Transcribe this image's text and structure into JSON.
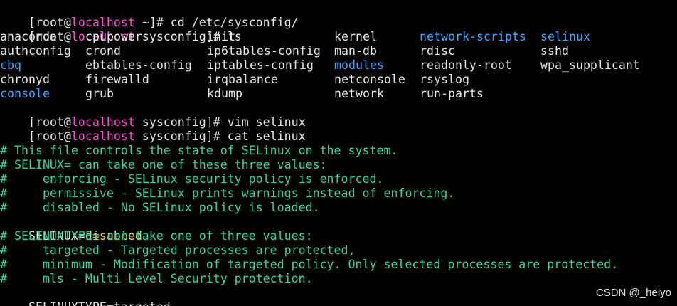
{
  "colors": {
    "background": "#000000",
    "text": "#e6e6e6",
    "host": "#ff4ad6",
    "comment": "#2ed8a2",
    "directory": "#3aa9ff",
    "value": "#e8dc4a"
  },
  "top_partial_line": "[root@localhost ~]# cd /etc/sysconfig/",
  "lines": [
    {
      "user": "[root@",
      "host": "localhost",
      "rest": " ~]# cd /etc/sysconfig/"
    },
    {
      "user": "[root@",
      "host": "localhost",
      "rest": " sysconfig]# ls"
    },
    {
      "user": "[root@",
      "host": "localhost",
      "rest": " sysconfig]# vim selinux"
    },
    {
      "user": "[root@",
      "host": "localhost",
      "rest": " sysconfig]# cat selinux"
    }
  ],
  "ls_grid": [
    [
      "anaconda",
      "cpupower",
      "init",
      "kernel",
      "network-scripts",
      "selinux"
    ],
    [
      "authconfig",
      "crond",
      "ip6tables-config",
      "man-db",
      "rdisc",
      "sshd"
    ],
    [
      "cbq",
      "ebtables-config",
      "iptables-config",
      "modules",
      "readonly-root",
      "wpa_supplicant"
    ],
    [
      "chronyd",
      "firewalld",
      "irqbalance",
      "netconsole",
      "rsyslog",
      ""
    ],
    [
      "console",
      "grub",
      "kdump",
      "network",
      "run-parts",
      ""
    ]
  ],
  "ls_dirs": [
    "network-scripts",
    "selinux",
    "cbq",
    "modules",
    "console"
  ],
  "file": {
    "comment_1": "# This file controls the state of SELinux on the system.",
    "comment_2": "# SELINUX= can take one of these three values:",
    "comment_3": "#     enforcing - SELinux security policy is enforced.",
    "comment_4": "#     permissive - SELinux prints warnings instead of enforcing.",
    "comment_5": "#     disabled - No SELinux policy is loaded.",
    "selinux_key": "SELINUX=",
    "selinux_value": "disabled",
    "comment_6": "# SELINUXTYPE= can take one of three values:",
    "comment_7": "#     targeted - Targeted processes are protected,",
    "comment_8": "#     minimum - Modification of targeted policy. Only selected processes are protected.",
    "comment_9": "#     mls - Multi Level Security protection.",
    "selinuxtype_key": "SELINUXTYPE=",
    "selinuxtype_value": "targeted"
  },
  "watermark": "CSDN @_heiyo"
}
